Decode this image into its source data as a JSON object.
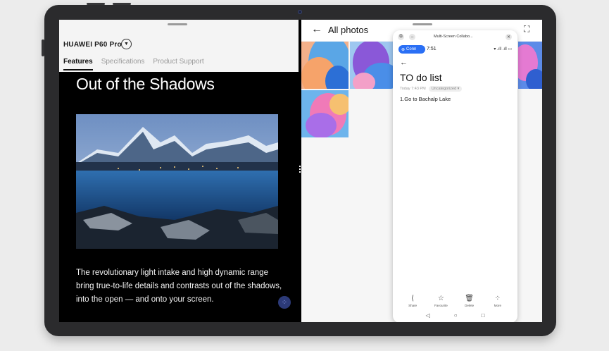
{
  "left_app": {
    "brand": "HUAWEI P60 Pro",
    "tabs": [
      {
        "label": "Features",
        "active": true
      },
      {
        "label": "Specifications",
        "active": false
      },
      {
        "label": "Product Support",
        "active": false
      }
    ],
    "hero_title": "Out of the Shadows",
    "hero_body": "The revolutionary light intake and high dynamic range bring true-to-life details and contrasts out of the shadows, into the open — and onto your screen."
  },
  "gallery": {
    "title": "All photos"
  },
  "phone": {
    "window_title": "Multi-Screen Collabo...",
    "connect_label": "Conn",
    "time": "7:51",
    "status_icons": "▾ .ıll .ıll ▭",
    "note_title": "TO do list",
    "note_date": "Today 7:43 PM",
    "note_category": "Uncategorized",
    "note_item": "1.Go to  Bachalp Lake",
    "toolbar": [
      {
        "label": "Share",
        "icon": "share-icon",
        "glyph": "⟨"
      },
      {
        "label": "Favourite",
        "icon": "star-icon",
        "glyph": "☆"
      },
      {
        "label": "Delete",
        "icon": "trash-icon",
        "glyph": "🗑"
      },
      {
        "label": "More",
        "icon": "more-icon",
        "glyph": "⁘"
      }
    ]
  },
  "colors": {
    "accent_blue": "#2a6ff5",
    "fab": "#2c3a78",
    "tablet_bezel": "#2b2b2d"
  }
}
